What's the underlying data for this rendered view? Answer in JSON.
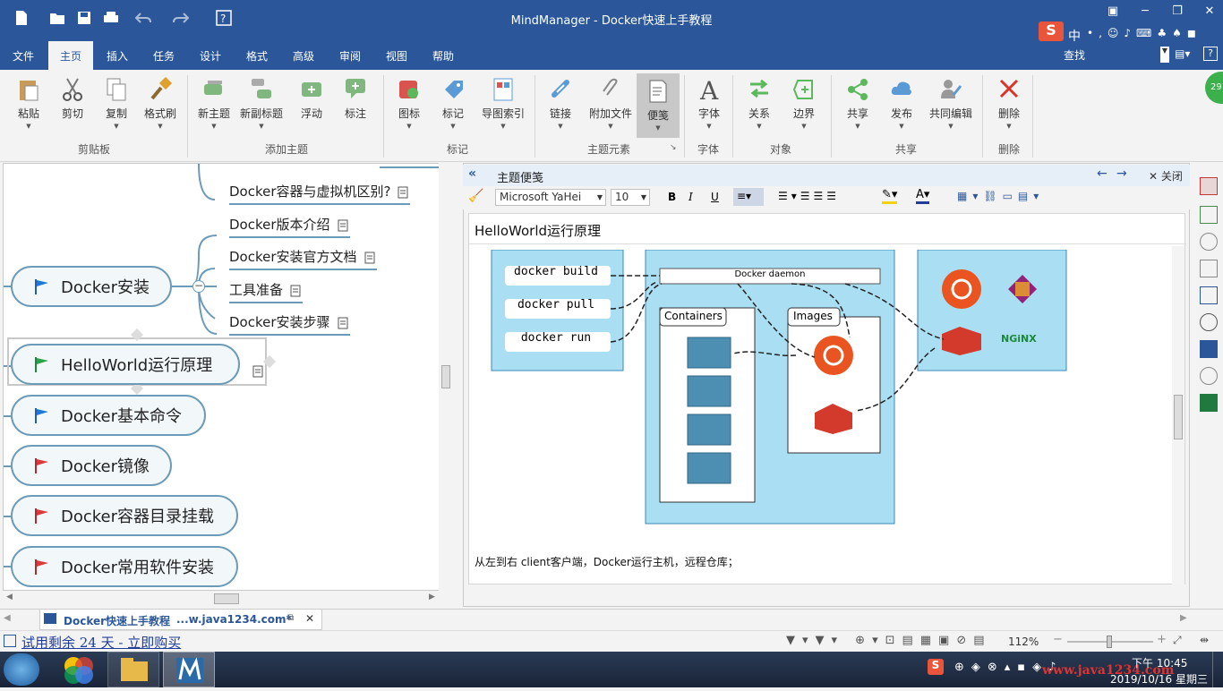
{
  "window": {
    "title": "MindManager - Docker快速上手教程"
  },
  "ime": {
    "mode": "中"
  },
  "tabs": [
    "文件",
    "主页",
    "插入",
    "任务",
    "设计",
    "格式",
    "高级",
    "审阅",
    "视图",
    "帮助"
  ],
  "search": {
    "label": "查找"
  },
  "ribbon": {
    "buttons": [
      "粘贴",
      "剪切",
      "复制",
      "格式刷",
      "新主题",
      "新副标题",
      "浮动",
      "标注",
      "图标",
      "标记",
      "导图索引",
      "链接",
      "附加文件",
      "便笺",
      "字体",
      "关系",
      "边界",
      "共享",
      "发布",
      "共同编辑",
      "删除"
    ],
    "groups": [
      "剪贴板",
      "添加主题",
      "标记",
      "主题元素",
      "字体",
      "对象",
      "共享",
      "删除"
    ]
  },
  "badge": "29",
  "map": {
    "subtopics": [
      "Docker容器与虚拟机区别?",
      "Docker版本介绍",
      "Docker安装官方文档",
      "工具准备",
      "Docker安装步骤"
    ],
    "topics": [
      "Docker安装",
      "HelloWorld运行原理",
      "Docker基本命令",
      "Docker镜像",
      "Docker容器目录挂载",
      "Docker常用软件安装"
    ],
    "collapse_symbol": "−"
  },
  "notes_pane": {
    "title": "主题便笺",
    "close_label": "关闭",
    "font": "Microsoft YaHei",
    "size": "10",
    "bold": "B",
    "italic": "I",
    "underline": "U",
    "note_title": "HelloWorld运行原理",
    "note_text": "从左到右 client客户端，Docker运行主机，远程仓库；"
  },
  "diagram": {
    "commands": [
      "docker build",
      "docker pull",
      "docker run"
    ],
    "daemon": "Docker daemon",
    "containers": "Containers",
    "images": "Images",
    "nginx": "NGiNX"
  },
  "doc_tab": {
    "name": "Docker快速上手教程",
    "url": "...w.java1234.com*"
  },
  "status": {
    "trial": "试用剩余 24 天 - 立即购买",
    "zoom": "112%"
  },
  "taskbar": {
    "time": "下午 10:45",
    "date": "2019/10/16 星期三",
    "watermark": "www.java1234.com"
  }
}
